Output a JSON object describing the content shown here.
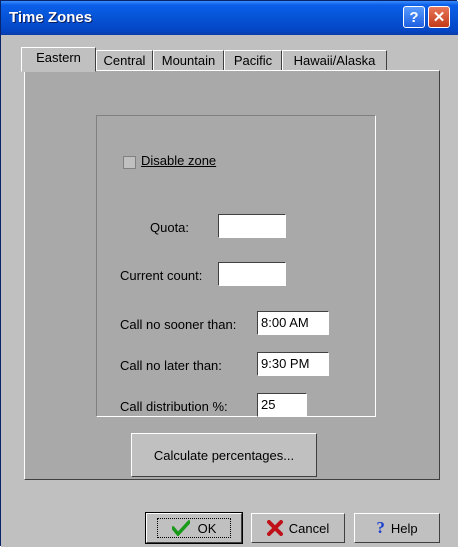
{
  "window": {
    "title": "Time Zones"
  },
  "tabs": [
    "Eastern",
    "Central",
    "Mountain",
    "Pacific",
    "Hawaii/Alaska"
  ],
  "active_tab": "Eastern",
  "form": {
    "disable_zone_label": "Disable zone",
    "disable_zone_checked": false,
    "quota_label": "Quota:",
    "quota_value": "",
    "current_count_label": "Current count:",
    "current_count_value": "",
    "call_no_sooner_label": "Call no sooner than:",
    "call_no_sooner_value": "8:00 AM",
    "call_no_later_label": "Call no later than:",
    "call_no_later_value": "9:30 PM",
    "call_distribution_label": "Call distribution %:",
    "call_distribution_value": "25",
    "calculate_label": "Calculate percentages..."
  },
  "buttons": {
    "ok": "OK",
    "cancel": "Cancel",
    "help": "Help"
  },
  "colors": {
    "title_bar": "#0653d6",
    "panel": "#a9a9a9",
    "dialog": "#c0c0c0"
  }
}
